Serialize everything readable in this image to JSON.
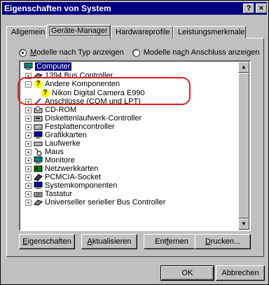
{
  "window": {
    "title": "Eigenschaften von System",
    "help_btn": "?",
    "close_btn": "×"
  },
  "tabs": [
    {
      "label": "Allgemein",
      "active": false
    },
    {
      "label": "Geräte-Manager",
      "active": true
    },
    {
      "label": "Hardwareprofile",
      "active": false
    },
    {
      "label": "Leistungsmerkmale",
      "active": false
    }
  ],
  "view": {
    "by_type_pre": "",
    "by_type_u": "M",
    "by_type_post": "odelle nach Typ anzeigen",
    "by_conn_pre": "Modelle na",
    "by_conn_u": "c",
    "by_conn_post": "h Anschluss anzeigen"
  },
  "tree": {
    "root": "Computer",
    "items": [
      {
        "label": "1394 Bus Controller",
        "icon": "1394-controller-icon",
        "expander": "+"
      },
      {
        "label": "Andere Komponenten",
        "icon": "unknown-device-icon",
        "expander": "−"
      },
      {
        "label": "Nikon Digital Camera E990",
        "icon": "unknown-device-icon",
        "expander": ""
      },
      {
        "label": "Anschlüsse (COM und LPT)",
        "icon": "port-icon",
        "expander": "+"
      },
      {
        "label": "CD-ROM",
        "icon": "cdrom-icon",
        "expander": "+"
      },
      {
        "label": "Diskettenlaufwerk-Controller",
        "icon": "floppy-controller-icon",
        "expander": "+"
      },
      {
        "label": "Festplattencontroller",
        "icon": "harddisk-controller-icon",
        "expander": "+"
      },
      {
        "label": "Grafikkarten",
        "icon": "display-adapter-icon",
        "expander": "+"
      },
      {
        "label": "Laufwerke",
        "icon": "drive-icon",
        "expander": "+"
      },
      {
        "label": "Maus",
        "icon": "mouse-icon",
        "expander": "+"
      },
      {
        "label": "Monitore",
        "icon": "monitor-icon",
        "expander": "+"
      },
      {
        "label": "Netzwerkkarten",
        "icon": "network-adapter-icon",
        "expander": "+"
      },
      {
        "label": "PCMCIA-Socket",
        "icon": "pcmcia-icon",
        "expander": "+"
      },
      {
        "label": "Systemkomponenten",
        "icon": "system-device-icon",
        "expander": "+"
      },
      {
        "label": "Tastatur",
        "icon": "keyboard-icon",
        "expander": "+"
      },
      {
        "label": "Universeller serieller Bus Controller",
        "icon": "usb-controller-icon",
        "expander": "+"
      }
    ]
  },
  "buttons": {
    "properties_u": "E",
    "properties_rest": "igenschaften",
    "refresh_u": "A",
    "refresh_rest": "ktualisieren",
    "remove_pre": "Ent",
    "remove_u": "f",
    "remove_rest": "ernen",
    "print_u": "D",
    "print_rest": "rucken...",
    "ok": "OK",
    "cancel": "Abbrechen"
  },
  "colors": {
    "title_bar": "#000080",
    "selection": "#000080",
    "callout": "#e01e1e",
    "face": "#c0c0c0"
  }
}
